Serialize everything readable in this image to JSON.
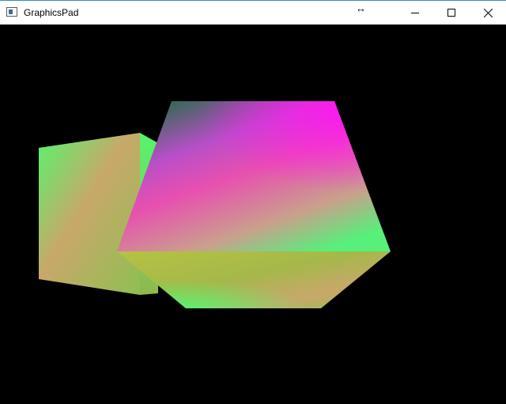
{
  "window": {
    "title": "GraphicsPad",
    "icon": "app-window-icon",
    "resize_glyph": "↔",
    "controls": {
      "minimize": "minimize-icon",
      "maximize": "maximize-icon",
      "close": "close-icon"
    }
  },
  "colors": {
    "titlebar": "#ffffff",
    "viewport": "#000000",
    "green": "#56f56c",
    "tan": "#c8a86a",
    "olive": "#a5b84a",
    "magenta": "#ff18f0",
    "pink": "#e84fb0",
    "dark_green": "#1d6e3e"
  }
}
